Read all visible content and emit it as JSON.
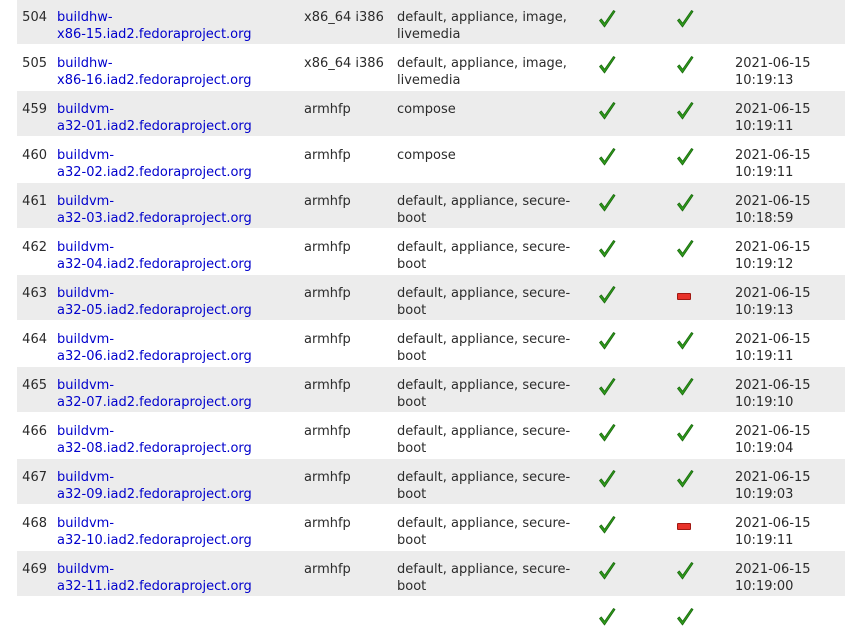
{
  "hosts": [
    {
      "id": "504",
      "name": "buildhw-\nx86-15.iad2.fedoraproject.org",
      "arches": "x86_64 i386",
      "channels": "default, appliance, image,\nlivemedia",
      "enabled": "check",
      "ready": "check",
      "last_update": ""
    },
    {
      "id": "505",
      "name": "buildhw-\nx86-16.iad2.fedoraproject.org",
      "arches": "x86_64 i386",
      "channels": "default, appliance, image,\nlivemedia",
      "enabled": "check",
      "ready": "check",
      "last_update": "2021-06-15\n10:19:13"
    },
    {
      "id": "459",
      "name": "buildvm-\na32-01.iad2.fedoraproject.org",
      "arches": "armhfp",
      "channels": "compose",
      "enabled": "check",
      "ready": "check",
      "last_update": "2021-06-15\n10:19:11"
    },
    {
      "id": "460",
      "name": "buildvm-\na32-02.iad2.fedoraproject.org",
      "arches": "armhfp",
      "channels": "compose",
      "enabled": "check",
      "ready": "check",
      "last_update": "2021-06-15\n10:19:11"
    },
    {
      "id": "461",
      "name": "buildvm-\na32-03.iad2.fedoraproject.org",
      "arches": "armhfp",
      "channels": "default, appliance, secure-\nboot",
      "enabled": "check",
      "ready": "check",
      "last_update": "2021-06-15\n10:18:59"
    },
    {
      "id": "462",
      "name": "buildvm-\na32-04.iad2.fedoraproject.org",
      "arches": "armhfp",
      "channels": "default, appliance, secure-\nboot",
      "enabled": "check",
      "ready": "check",
      "last_update": "2021-06-15\n10:19:12"
    },
    {
      "id": "463",
      "name": "buildvm-\na32-05.iad2.fedoraproject.org",
      "arches": "armhfp",
      "channels": "default, appliance, secure-\nboot",
      "enabled": "check",
      "ready": "minus",
      "last_update": "2021-06-15\n10:19:13"
    },
    {
      "id": "464",
      "name": "buildvm-\na32-06.iad2.fedoraproject.org",
      "arches": "armhfp",
      "channels": "default, appliance, secure-\nboot",
      "enabled": "check",
      "ready": "check",
      "last_update": "2021-06-15\n10:19:11"
    },
    {
      "id": "465",
      "name": "buildvm-\na32-07.iad2.fedoraproject.org",
      "arches": "armhfp",
      "channels": "default, appliance, secure-\nboot",
      "enabled": "check",
      "ready": "check",
      "last_update": "2021-06-15\n10:19:10"
    },
    {
      "id": "466",
      "name": "buildvm-\na32-08.iad2.fedoraproject.org",
      "arches": "armhfp",
      "channels": "default, appliance, secure-\nboot",
      "enabled": "check",
      "ready": "check",
      "last_update": "2021-06-15\n10:19:04"
    },
    {
      "id": "467",
      "name": "buildvm-\na32-09.iad2.fedoraproject.org",
      "arches": "armhfp",
      "channels": "default, appliance, secure-\nboot",
      "enabled": "check",
      "ready": "check",
      "last_update": "2021-06-15\n10:19:03"
    },
    {
      "id": "468",
      "name": "buildvm-\na32-10.iad2.fedoraproject.org",
      "arches": "armhfp",
      "channels": "default, appliance, secure-\nboot",
      "enabled": "check",
      "ready": "minus",
      "last_update": "2021-06-15\n10:19:11"
    },
    {
      "id": "469",
      "name": "buildvm-\na32-11.iad2.fedoraproject.org",
      "arches": "armhfp",
      "channels": "default, appliance, secure-\nboot",
      "enabled": "check",
      "ready": "check",
      "last_update": "2021-06-15\n10:19:00"
    },
    {
      "id": "",
      "name": "",
      "arches": "",
      "channels": "",
      "enabled": "check",
      "ready": "check",
      "last_update": ""
    }
  ],
  "icons": {
    "check": "green-checkmark-icon",
    "minus": "red-minus-icon"
  },
  "colors": {
    "link": "#0000cc",
    "row_alt": "#ececec",
    "check": "#2e9a1c",
    "minus": "#e8322a"
  }
}
